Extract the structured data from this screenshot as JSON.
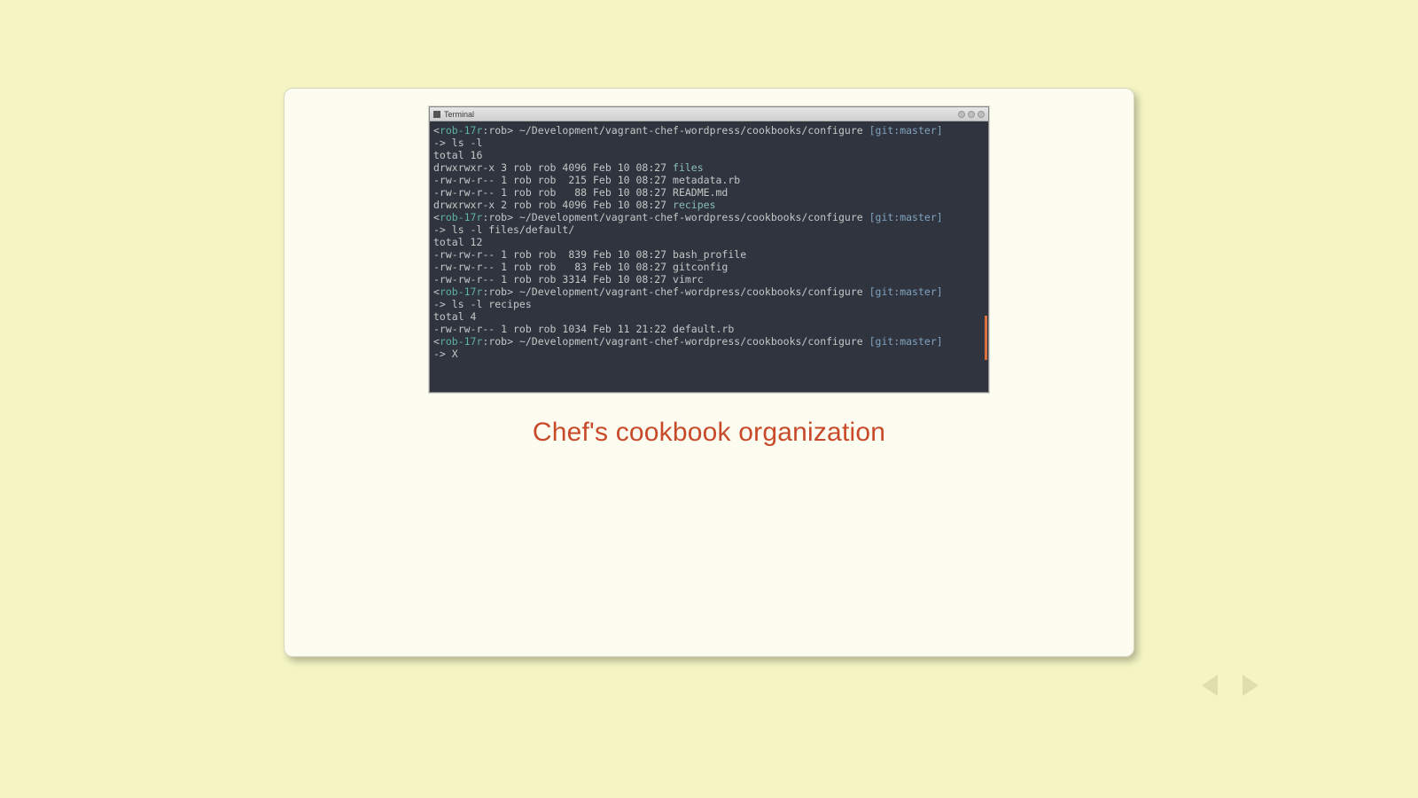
{
  "slide": {
    "caption": "Chef's cookbook organization"
  },
  "terminal": {
    "title": "Terminal",
    "prompt": {
      "host": "rob-17r",
      "user": "rob",
      "cwd": "~/Development/vagrant-chef-wordpress/cookbooks/configure",
      "git": "[git:master]",
      "arrow": "-> "
    },
    "blocks": [
      {
        "cmd": "ls -l",
        "total": "total 16",
        "rows": [
          {
            "perm": "drwxrwxr-x",
            "n": "3",
            "own": "rob",
            "grp": "rob",
            "size": "4096",
            "date": "Feb 10 08:27",
            "name": "files",
            "dir": true
          },
          {
            "perm": "-rw-rw-r--",
            "n": "1",
            "own": "rob",
            "grp": "rob",
            "size": " 215",
            "date": "Feb 10 08:27",
            "name": "metadata.rb",
            "dir": false
          },
          {
            "perm": "-rw-rw-r--",
            "n": "1",
            "own": "rob",
            "grp": "rob",
            "size": "  88",
            "date": "Feb 10 08:27",
            "name": "README.md",
            "dir": false
          },
          {
            "perm": "drwxrwxr-x",
            "n": "2",
            "own": "rob",
            "grp": "rob",
            "size": "4096",
            "date": "Feb 10 08:27",
            "name": "recipes",
            "dir": true
          }
        ]
      },
      {
        "cmd": "ls -l files/default/",
        "total": "total 12",
        "rows": [
          {
            "perm": "-rw-rw-r--",
            "n": "1",
            "own": "rob",
            "grp": "rob",
            "size": " 839",
            "date": "Feb 10 08:27",
            "name": "bash_profile",
            "dir": false
          },
          {
            "perm": "-rw-rw-r--",
            "n": "1",
            "own": "rob",
            "grp": "rob",
            "size": "  83",
            "date": "Feb 10 08:27",
            "name": "gitconfig",
            "dir": false
          },
          {
            "perm": "-rw-rw-r--",
            "n": "1",
            "own": "rob",
            "grp": "rob",
            "size": "3314",
            "date": "Feb 10 08:27",
            "name": "vimrc",
            "dir": false
          }
        ]
      },
      {
        "cmd": "ls -l recipes",
        "total": "total 4",
        "rows": [
          {
            "perm": "-rw-rw-r--",
            "n": "1",
            "own": "rob",
            "grp": "rob",
            "size": "1034",
            "date": "Feb 11 21:22",
            "name": "default.rb",
            "dir": false
          }
        ]
      }
    ],
    "cursor": "X"
  }
}
